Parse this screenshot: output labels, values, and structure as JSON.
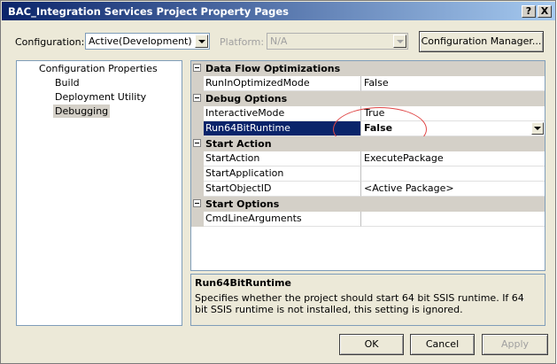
{
  "window": {
    "title": "BAC_Integration Services Project Property Pages",
    "help_label": "?",
    "close_label": "X"
  },
  "config": {
    "configuration_label": "Configuration:",
    "configuration_value": "Active(Development)",
    "platform_label": "Platform:",
    "platform_value": "N/A",
    "manager_button": "Configuration Manager..."
  },
  "tree": {
    "root": "Configuration Properties",
    "items": [
      "Build",
      "Deployment Utility",
      "Debugging"
    ],
    "selected": "Debugging"
  },
  "grid": {
    "categories": [
      {
        "name": "Data Flow Optimizations",
        "props": [
          {
            "name": "RunInOptimizedMode",
            "value": "False"
          }
        ]
      },
      {
        "name": "Debug Options",
        "props": [
          {
            "name": "InteractiveMode",
            "value": "True"
          },
          {
            "name": "Run64BitRuntime",
            "value": "False"
          }
        ]
      },
      {
        "name": "Start Action",
        "props": [
          {
            "name": "StartAction",
            "value": "ExecutePackage"
          },
          {
            "name": "StartApplication",
            "value": ""
          },
          {
            "name": "StartObjectID",
            "value": "<Active Package>"
          }
        ]
      },
      {
        "name": "Start Options",
        "props": [
          {
            "name": "CmdLineArguments",
            "value": ""
          }
        ]
      }
    ],
    "selected_property": "Run64BitRuntime"
  },
  "description": {
    "title": "Run64BitRuntime",
    "text": "Specifies whether the project should start 64 bit SSIS runtime. If 64 bit SSIS runtime is not installed, this setting is ignored."
  },
  "buttons": {
    "ok": "OK",
    "cancel": "Cancel",
    "apply": "Apply"
  }
}
